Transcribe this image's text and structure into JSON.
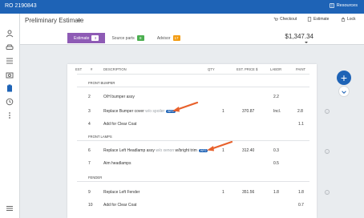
{
  "topbar": {
    "ro_number": "RO 2190843",
    "resources_label": "Resources"
  },
  "header": {
    "title": "Preliminary Estimate",
    "tools": [
      {
        "label": "Checkout",
        "icon": "cart-icon"
      },
      {
        "label": "Estimate",
        "icon": "estimate-icon"
      },
      {
        "label": "Lock",
        "icon": "lock-icon"
      }
    ],
    "total": "$1,347.34"
  },
  "tabs": [
    {
      "label": "Estimate",
      "count": "3",
      "badge_color": "#8e5bb5"
    },
    {
      "label": "Source parts",
      "count": "8",
      "badge_color": "#4caf50"
    },
    {
      "label": "Advisor",
      "count": "17",
      "badge_color": "#f39c12"
    }
  ],
  "table": {
    "columns": [
      "EST",
      "#",
      "DESCRIPTION",
      "QTY",
      "EST. PRICE $",
      "LABOR",
      "PAINT"
    ],
    "sections": [
      {
        "name": "FRONT BUMPER",
        "rows": [
          {
            "num": "2",
            "desc": "O/H bumper assy",
            "qty": "",
            "price": "",
            "labor": "2.2",
            "paint": ""
          },
          {
            "num": "3",
            "desc": "Replace Bumper cover",
            "desc_muted": "w/o spoiler",
            "qty": "1",
            "price": "370.87",
            "labor": "Incl.",
            "paint": "2.8"
          },
          {
            "num": "4",
            "desc": "Add for Clear Coat",
            "qty": "",
            "price": "",
            "labor": "",
            "paint": "1.1"
          }
        ]
      },
      {
        "name": "FRONT LAMPS",
        "rows": [
          {
            "num": "6",
            "desc": "Replace Left Headlamp assy",
            "desc_muted": "w/o xenon",
            "desc_tail": "w/bright trim",
            "qty": "1",
            "price": "312.40",
            "labor": "0.3",
            "paint": ""
          },
          {
            "num": "7",
            "desc": "Aim headlamps",
            "qty": "",
            "price": "",
            "labor": "0.5",
            "paint": ""
          }
        ]
      },
      {
        "name": "FENDER",
        "rows": [
          {
            "num": "9",
            "desc": "Replace Left Fender",
            "qty": "1",
            "price": "351.56",
            "labor": "1.8",
            "paint": "1.8"
          },
          {
            "num": "10",
            "desc": "Add for Clear Coat",
            "qty": "",
            "price": "",
            "labor": "",
            "paint": "0.7"
          }
        ]
      }
    ],
    "tag_label": "INFO"
  },
  "colors": {
    "primary": "#1e63b6",
    "accent_tab": "#8e5bb5",
    "arrow": "#e8612c"
  }
}
